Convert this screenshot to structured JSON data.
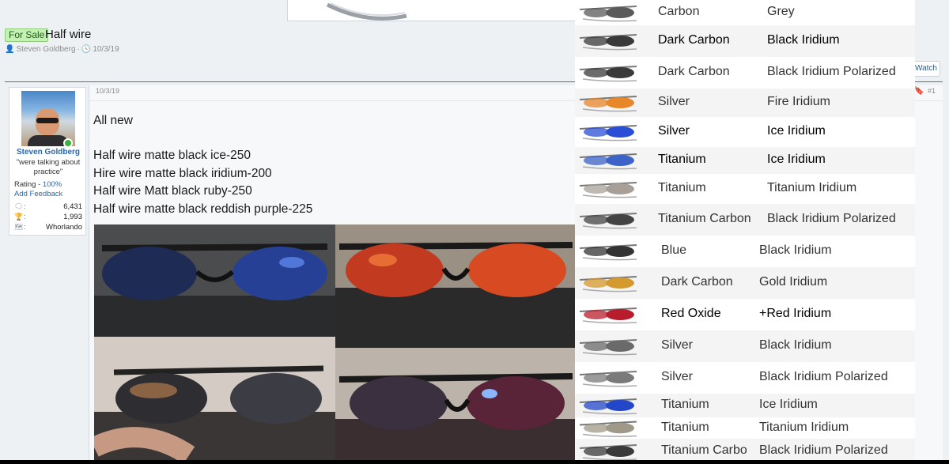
{
  "thread": {
    "prefix": "For Sale",
    "title": "Half wire",
    "author": "Steven Goldberg",
    "meta_sep": "·",
    "date": "10/3/19",
    "watch_label": "Watch"
  },
  "post": {
    "date": "10/3/19",
    "number": "#1",
    "lines": [
      "All new",
      "Half wire matte black ice-250",
      "Hire wire matte black iridium-200",
      "Half wire Matt black ruby-250",
      "Half wire matte black reddish purple-225"
    ]
  },
  "user": {
    "name": "Steven Goldberg",
    "title": "\"were talking about practice\"",
    "rating_label": "Rating - ",
    "rating_value": "100%",
    "feedback_link": "Add Feedback",
    "stats": [
      {
        "icon": "messages-icon",
        "glyph": "🗨",
        "value": "6,431"
      },
      {
        "icon": "trophy-icon",
        "glyph": "🏆",
        "value": "1,993"
      },
      {
        "icon": "location-icon",
        "glyph": "🗺",
        "value": "Whorlando"
      }
    ]
  },
  "catalog": {
    "rows": [
      {
        "frame": "Carbon",
        "lens": "Grey",
        "lens_color": "#5a5a5a",
        "bold": false
      },
      {
        "frame": "Dark Carbon",
        "lens": "Black Iridium",
        "lens_color": "#3a3a3a",
        "bold": true
      },
      {
        "frame": "Dark Carbon",
        "lens": "Black Iridium Polarized",
        "lens_color": "#3a3a3a",
        "bold": false
      },
      {
        "frame": "Silver",
        "lens": "Fire Iridium",
        "lens_color": "#e8862a",
        "bold": false
      },
      {
        "frame": "Silver",
        "lens": "Ice Iridium",
        "lens_color": "#2a4fd6",
        "bold": true
      },
      {
        "frame": "Titanium",
        "lens": "Ice Iridium",
        "lens_color": "#3b63c8",
        "bold": true
      },
      {
        "frame": "Titanium",
        "lens": "Titanium Iridium",
        "lens_color": "#a8a098",
        "bold": false
      },
      {
        "frame": "Titanium Carbon",
        "lens": "Black Iridium Polarized",
        "lens_color": "#444444",
        "bold": false
      },
      {
        "frame": "Blue",
        "lens": "Black Iridium",
        "lens_color": "#333333",
        "bold": false
      },
      {
        "frame": "Dark Carbon",
        "lens": "Gold Iridium",
        "lens_color": "#d49a2e",
        "bold": false
      },
      {
        "frame": "Red Oxide",
        "lens": "+Red Iridium",
        "lens_color": "#b81d2e",
        "bold": true
      },
      {
        "frame": "Silver",
        "lens": "Black Iridium",
        "lens_color": "#6a6a6a",
        "bold": false
      },
      {
        "frame": "Silver",
        "lens": "Black Iridium Polarized",
        "lens_color": "#7a7a7a",
        "bold": false
      },
      {
        "frame": "Titanium",
        "lens": "Ice Iridium",
        "lens_color": "#2347c8",
        "bold": false
      },
      {
        "frame": "Titanium",
        "lens": "Titanium Iridium",
        "lens_color": "#a09888",
        "bold": false
      },
      {
        "frame": "Titanium Carbo",
        "lens": "Black Iridium Polarized",
        "lens_color": "#3a3a3a",
        "bold": false
      }
    ]
  },
  "photos": [
    {
      "label": "sunglasses-ice-lens-photo",
      "lens_color": "#2f4fa8"
    },
    {
      "label": "sunglasses-ruby-lens-photo",
      "lens_color": "#d23a1e"
    },
    {
      "label": "sunglasses-iridium-lens-photo",
      "lens_color": "#4a4a52"
    },
    {
      "label": "sunglasses-reddish-purple-lens-photo",
      "lens_color": "#5a2f52"
    }
  ]
}
